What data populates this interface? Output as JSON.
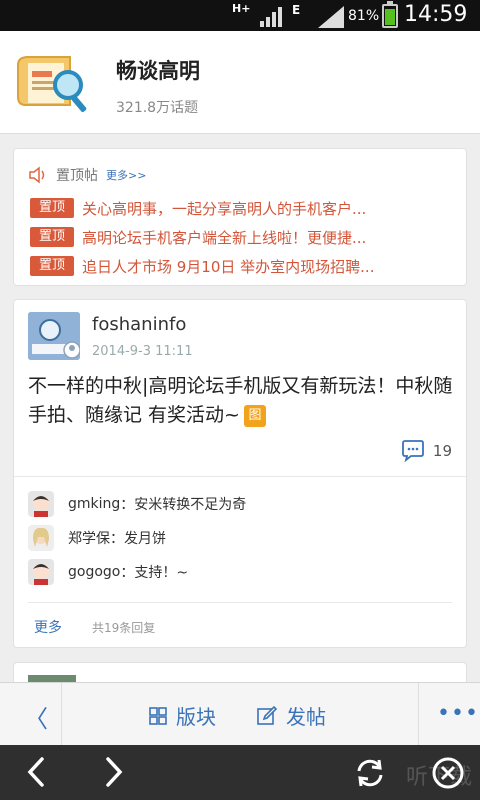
{
  "status_bar": {
    "network": "H+",
    "network2": "E",
    "battery": "81%",
    "battery_level": 0.81,
    "time": "14:59"
  },
  "header": {
    "title": "畅谈高明",
    "subtitle": "321.8万话题"
  },
  "sticky": {
    "label": "置顶帖",
    "more": "更多>>",
    "items": [
      {
        "tag": "置顶",
        "text": "关心高明事，一起分享高明人的手机客户..."
      },
      {
        "tag": "置顶",
        "text": "高明论坛手机客户端全新上线啦！更便捷..."
      },
      {
        "tag": "置顶",
        "text": "追日人才市场 9月10日 举办室内现场招聘..."
      }
    ]
  },
  "post": {
    "author": "foshaninfo",
    "date": "2014-9-3 11:11",
    "content": "不一样的中秋|高明论坛手机版又有新玩法！中秋随手拍、随缘记 有奖活动~",
    "image_badge": "图",
    "comment_count": "19",
    "replies": [
      {
        "user": "gmking",
        "text": "：安米转换不足为奇"
      },
      {
        "user": "郑学保",
        "text": "：发月饼"
      },
      {
        "user": "gogogo",
        "text": "：支持！~"
      }
    ],
    "more": "更多",
    "total": "共19条回复"
  },
  "toolbar": {
    "boards": "版块",
    "post": "发帖",
    "menu": "•••"
  },
  "watermark": "听下载",
  "colors": {
    "accent": "#3b73b9",
    "sticky_red": "#d95a3a",
    "image_badge": "#f3a21b"
  }
}
